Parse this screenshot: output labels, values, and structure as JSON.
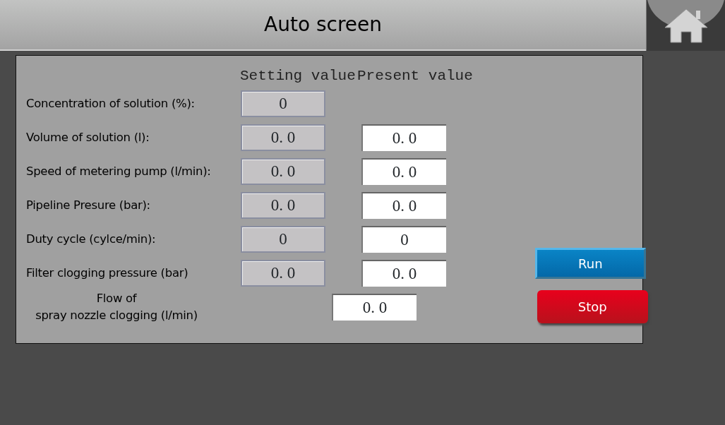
{
  "header": {
    "title": "Auto screen"
  },
  "columns": [
    "Setting value",
    "Present value"
  ],
  "rows": [
    {
      "label": "Concentration of solution (%):",
      "setting": "0"
    },
    {
      "label": "Volume of solution (l):",
      "setting": "0. 0",
      "present": "0. 0"
    },
    {
      "label": "Speed of metering pump (l/min):",
      "setting": "0. 0",
      "present": "0. 0"
    },
    {
      "label": "Pipeline Presure (bar):",
      "setting": "0. 0",
      "present": "0. 0"
    },
    {
      "label": "Duty cycle (cylce/min):",
      "setting": "0",
      "present": "0"
    },
    {
      "label": "Filter clogging pressure (bar)",
      "setting": "0. 0",
      "present": "0. 0"
    },
    {
      "label": "Flow of\nspray nozzle clogging (l/min)",
      "present": "0. 0"
    }
  ],
  "buttons": [
    {
      "label": "Run",
      "kind": "run"
    },
    {
      "label": "Stop",
      "kind": "stop"
    }
  ]
}
